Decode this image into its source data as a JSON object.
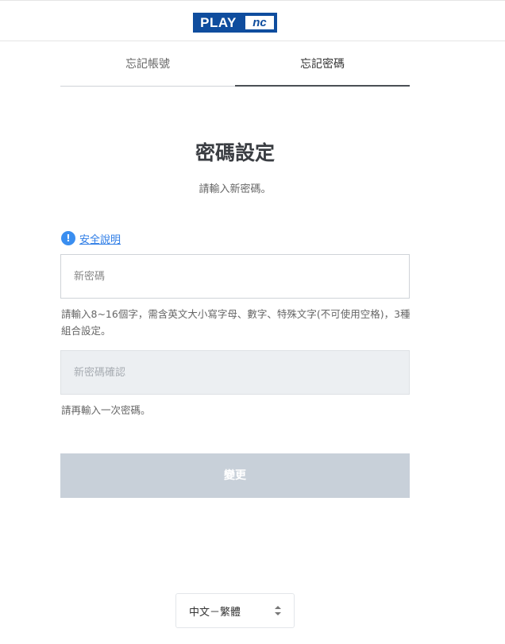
{
  "header": {
    "logo_play": "PLAY",
    "logo_nc": "nc"
  },
  "tabs": [
    {
      "label": "忘記帳號",
      "active": false
    },
    {
      "label": "忘記密碼",
      "active": true
    }
  ],
  "main": {
    "title": "密碼設定",
    "subtitle": "請輸入新密碼。",
    "security_link": "安全說明",
    "info_icon": "info-icon"
  },
  "form": {
    "new_password": {
      "placeholder": "新密碼",
      "value": "",
      "hint": "請輸入8~16個字，需含英文大小寫字母、數字、特殊文字(不可使用空格)，3種組合設定。"
    },
    "confirm_password": {
      "placeholder": "新密碼確認",
      "value": "",
      "disabled": true,
      "hint": "請再輸入一次密碼。"
    },
    "submit_label": "變更",
    "submit_disabled": true
  },
  "footer": {
    "language": "中文－繁體",
    "language_icon": "updown-chevron-icon"
  },
  "colors": {
    "brand": "#0f4d9e",
    "link": "#2b7be6",
    "info_icon": "#3a8ef0",
    "button_disabled": "#c8d0d9",
    "input_disabled_bg": "#eceff2"
  }
}
